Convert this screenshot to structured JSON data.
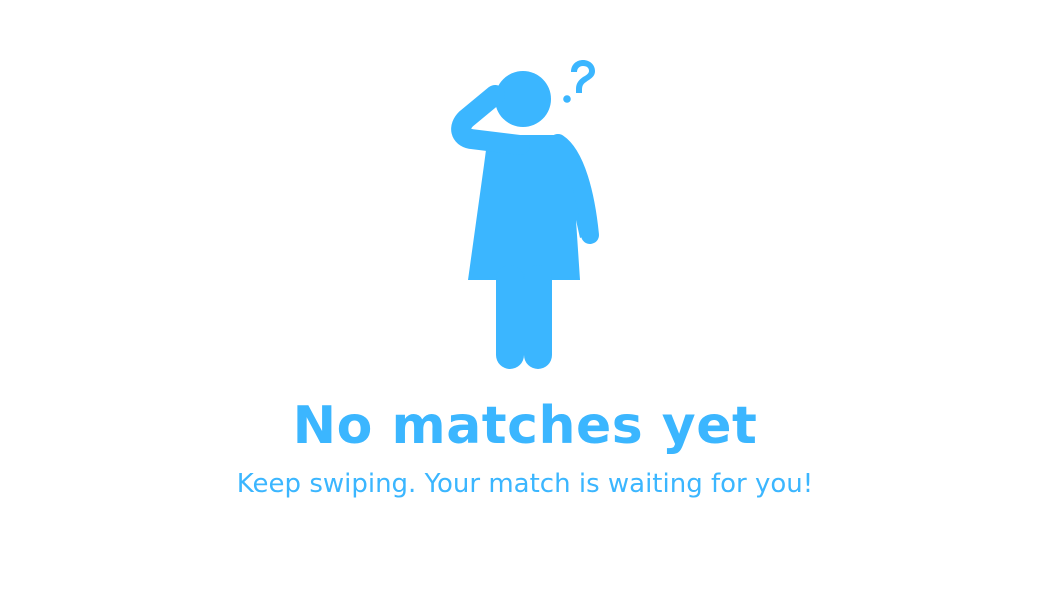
{
  "empty_state": {
    "icon": "confused-woman-icon",
    "title": "No matches yet",
    "message": "Keep swiping. Your match is waiting for you!"
  },
  "colors": {
    "accent": "#3BB6FF",
    "background": "#FFFFFF"
  }
}
